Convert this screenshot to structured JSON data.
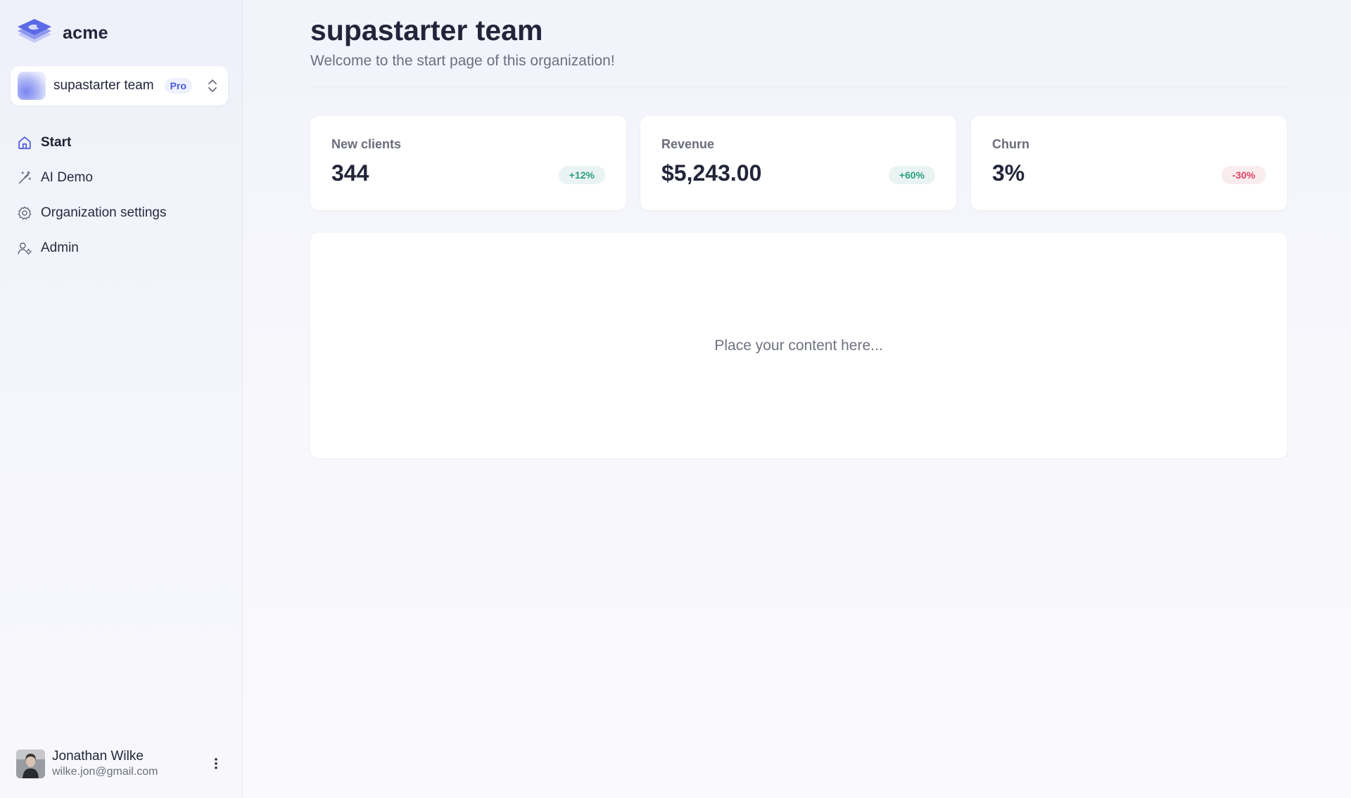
{
  "brand": {
    "name": "acme",
    "logo_icon": "layers-logo-icon"
  },
  "org_switcher": {
    "name": "supastarter team",
    "plan_badge": "Pro",
    "chevron_icon": "chevron-up-down-icon"
  },
  "nav": {
    "items": [
      {
        "label": "Start",
        "icon": "home-icon",
        "active": true
      },
      {
        "label": "AI Demo",
        "icon": "magic-wand-icon",
        "active": false
      },
      {
        "label": "Organization settings",
        "icon": "gear-icon",
        "active": false
      },
      {
        "label": "Admin",
        "icon": "user-cog-icon",
        "active": false
      }
    ]
  },
  "user": {
    "name": "Jonathan Wilke",
    "email": "wilke.jon@gmail.com",
    "menu_icon": "more-vertical-icon"
  },
  "header": {
    "title": "supastarter team",
    "subtitle": "Welcome to the start page of this organization!"
  },
  "stats": [
    {
      "label": "New clients",
      "value": "344",
      "delta": "+12%",
      "trend": "up"
    },
    {
      "label": "Revenue",
      "value": "$5,243.00",
      "delta": "+60%",
      "trend": "up"
    },
    {
      "label": "Churn",
      "value": "3%",
      "delta": "-30%",
      "trend": "down"
    }
  ],
  "content": {
    "placeholder": "Place your content here..."
  },
  "colors": {
    "accent": "#4a5ae0",
    "positive": "#2aa07a",
    "negative": "#e0435f",
    "text": "#22253a"
  }
}
